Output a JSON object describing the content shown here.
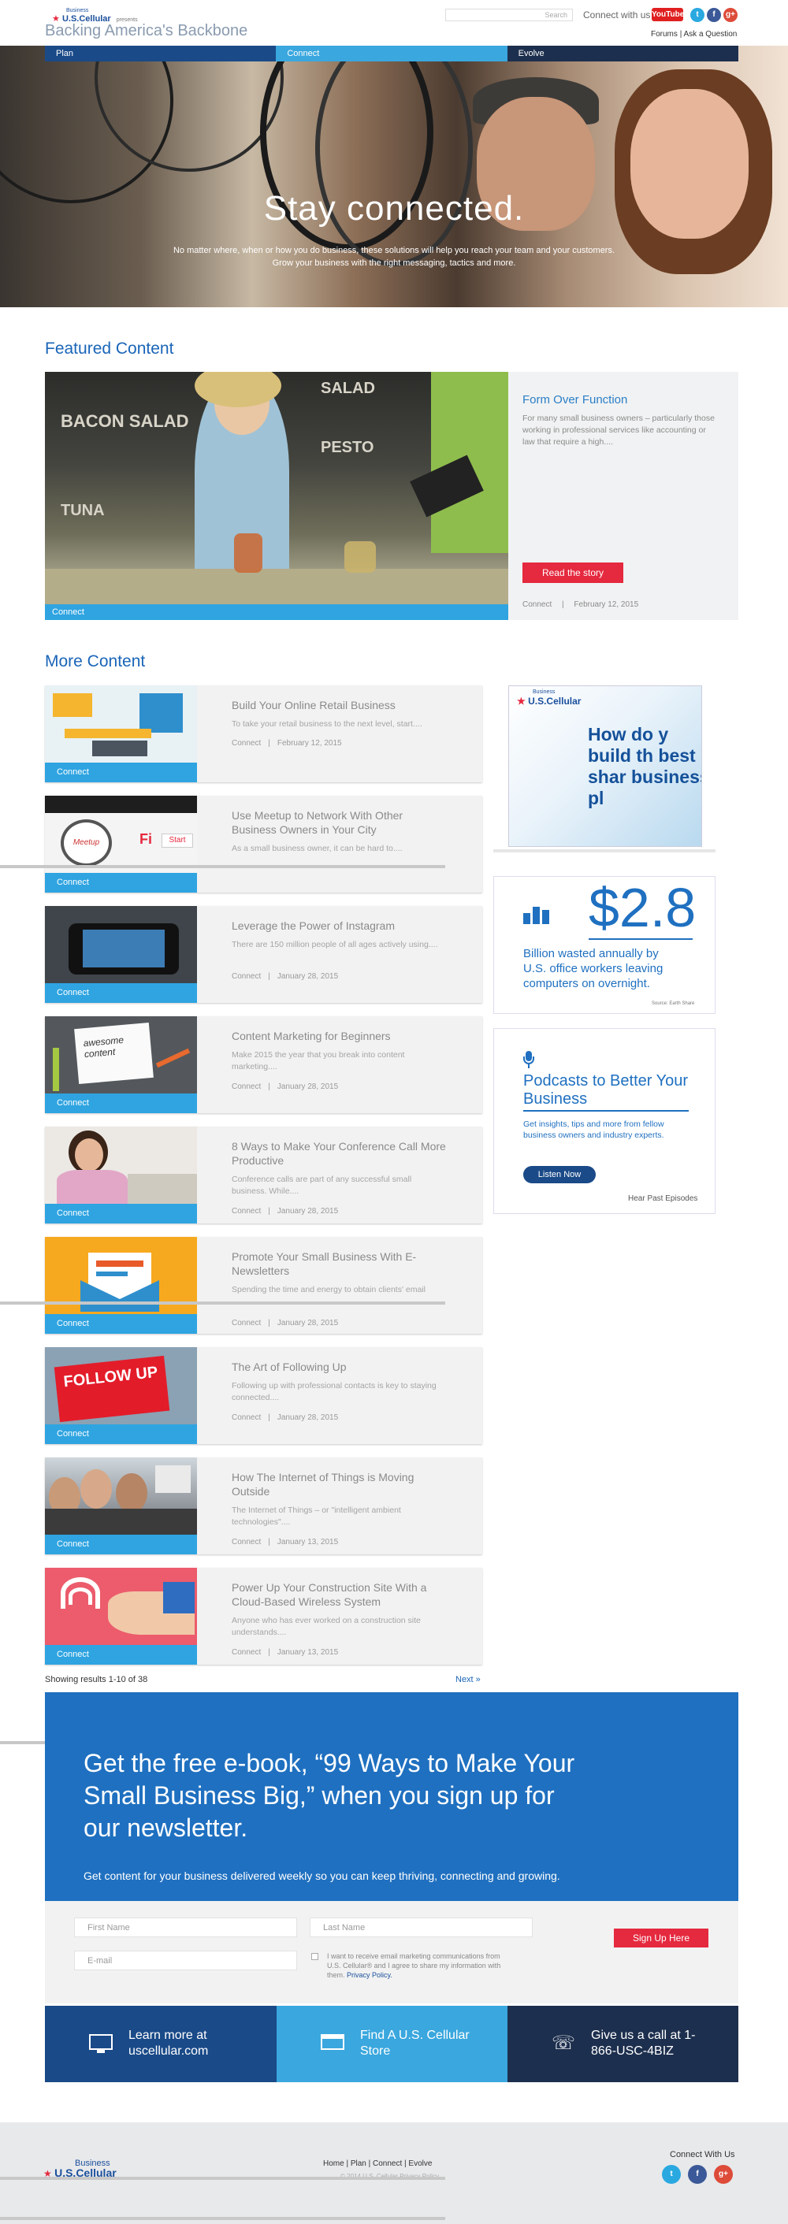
{
  "header": {
    "logo_top": "Business",
    "logo_brand": "U.S.Cellular",
    "logo_presents": "presents",
    "site_title": "Backing America's Backbone",
    "search_placeholder": "Search",
    "connect_label": "Connect with us",
    "youtube": "YouTube",
    "forums": "Forums",
    "ask": "Ask a Question"
  },
  "nav": [
    "Plan",
    "Connect",
    "Evolve"
  ],
  "hero": {
    "title": "Stay connected.",
    "subtitle": "No matter where, when or how you do business, these solutions will help you reach your team and your customers.  Grow your business with the right messaging, tactics and more."
  },
  "featured": {
    "section_title": "Featured Content",
    "tag": "Connect",
    "title": "Form Over Function",
    "desc": "For many small business owners – particularly those working in professional services like accounting or law that require a high....",
    "button": "Read the story",
    "meta_cat": "Connect",
    "meta_date": "February 12, 2015",
    "board_lines": [
      "BACON SALAD",
      "SALAD",
      "PESTO",
      "TUNA"
    ]
  },
  "more": {
    "section_title": "More Content",
    "cards": [
      {
        "title": "Build Your Online Retail Business",
        "desc": "To take your retail business to the next level, start....",
        "cat": "Connect",
        "date": "February 12, 2015",
        "tag": "Connect"
      },
      {
        "title": "Use Meetup to Network With Other Business Owners in Your City",
        "desc": "As a small business owner, it can be hard to....",
        "cat": "Connect",
        "date": "",
        "tag": "Connect"
      },
      {
        "title": "Leverage the Power of Instagram",
        "desc": "There are 150 million people of all ages actively using....",
        "cat": "Connect",
        "date": "January 28, 2015",
        "tag": "Connect"
      },
      {
        "title": "Content Marketing for Beginners",
        "desc": "Make 2015 the year that you break into content marketing....",
        "cat": "Connect",
        "date": "January 28, 2015",
        "tag": "Connect"
      },
      {
        "title": "8 Ways to Make Your Conference Call More Productive",
        "desc": "Conference calls are part of any successful small business. While....",
        "cat": "Connect",
        "date": "January 28, 2015",
        "tag": "Connect"
      },
      {
        "title": "Promote Your Small Business With E-Newsletters",
        "desc": "Spending the time and energy to obtain clients' email",
        "cat": "Connect",
        "date": "January 28, 2015",
        "tag": "Connect"
      },
      {
        "title": "The Art of Following Up",
        "desc": "Following up with professional contacts is key to staying connected....",
        "cat": "Connect",
        "date": "January 28, 2015",
        "tag": "Connect"
      },
      {
        "title": "How The Internet of Things is Moving Outside",
        "desc": "The Internet of Things – or \"intelligent ambient technologies\"....",
        "cat": "Connect",
        "date": "January 13, 2015",
        "tag": "Connect"
      },
      {
        "title": "Power Up Your Construction Site With a Cloud-Based Wireless System",
        "desc": "Anyone who has ever worked on a construction site understands....",
        "cat": "Connect",
        "date": "January 13, 2015",
        "tag": "Connect"
      }
    ],
    "thumb_texts": {
      "meetup": "Meetup",
      "fi": "Fi",
      "start": "Start",
      "content": "awesome content",
      "follow": "FOLLOW UP"
    }
  },
  "ad": {
    "brand_top": "Business",
    "brand": "U.S.Cellular",
    "text": "How do y build th best shar business pl"
  },
  "stat": {
    "value": "$2.8",
    "desc": "Billion wasted annually by U.S. office workers leaving computers on overnight.",
    "source": "Source: Earth Share"
  },
  "podcast": {
    "title": "Podcasts to Better Your Business",
    "desc": "Get insights, tips and more from fellow business owners and industry experts.",
    "button": "Listen Now",
    "link": "Hear Past Episodes"
  },
  "pagination": {
    "results": "Showing results 1-10 of 38",
    "next": "Next »"
  },
  "newsletter": {
    "title": "Get the free e-book, “99 Ways to Make Your Small Business Big,” when you sign up for our newsletter.",
    "sub": "Get content for your business delivered weekly so you can keep thriving, connecting and growing.",
    "first_name": "First Name",
    "last_name": "Last Name",
    "email": "E-mail",
    "legal": "I want to receive email marketing communications from U.S. Cellular® and I agree to share my information with them.",
    "privacy": "Privacy Policy.",
    "button": "Sign Up Here"
  },
  "cta": [
    {
      "text": "Learn more at uscellular.com",
      "color": "#1a4a88"
    },
    {
      "text": "Find A U.S. Cellular Store",
      "color": "#3aa7de"
    },
    {
      "text": "Give us a call at 1-866-USC-4BIZ",
      "color": "#1d2f4e"
    }
  ],
  "footer": {
    "logo_top": "Business",
    "logo_brand": "U.S.Cellular",
    "links": [
      "Home",
      "Plan",
      "Connect",
      "Evolve"
    ],
    "copyright": "© 2014 U.S. Cellular  Privacy Policy",
    "connect": "Connect With Us"
  },
  "colors": {
    "brand_blue": "#1a65b8",
    "cta_red": "#e5293e",
    "tag_blue": "#2fa4e1"
  }
}
